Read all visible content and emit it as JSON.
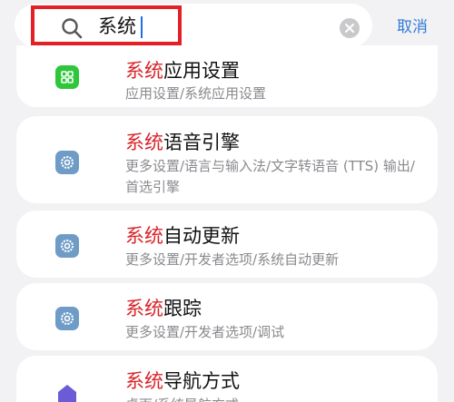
{
  "search": {
    "query": "系统",
    "cancel_label": "取消"
  },
  "results": [
    {
      "highlight": "系统",
      "title_rest": "应用设置",
      "path": "应用设置/系统应用设置",
      "icon": "app-grid-icon"
    },
    {
      "highlight": "系统",
      "title_rest": "语音引擎",
      "path": "更多设置/语言与输入法/文字转语音 (TTS) 输出/首选引擎",
      "icon": "gear-icon"
    },
    {
      "highlight": "系统",
      "title_rest": "自动更新",
      "path": "更多设置/开发者选项/系统自动更新",
      "icon": "gear-icon"
    },
    {
      "highlight": "系统",
      "title_rest": "跟踪",
      "path": "更多设置/开发者选项/调试",
      "icon": "gear-icon"
    },
    {
      "highlight": "系统",
      "title_rest": "导航方式",
      "path": "桌面/系统导航方式",
      "icon": "home-icon"
    }
  ],
  "colors": {
    "highlight": "#d8232a",
    "accent": "#2e7bd6",
    "annotation_box": "#e41f26",
    "app_icon_green": "#2fc63c",
    "gear_icon_blue": "#6f9cc6",
    "home_icon_purple": "#6b5bd6"
  }
}
